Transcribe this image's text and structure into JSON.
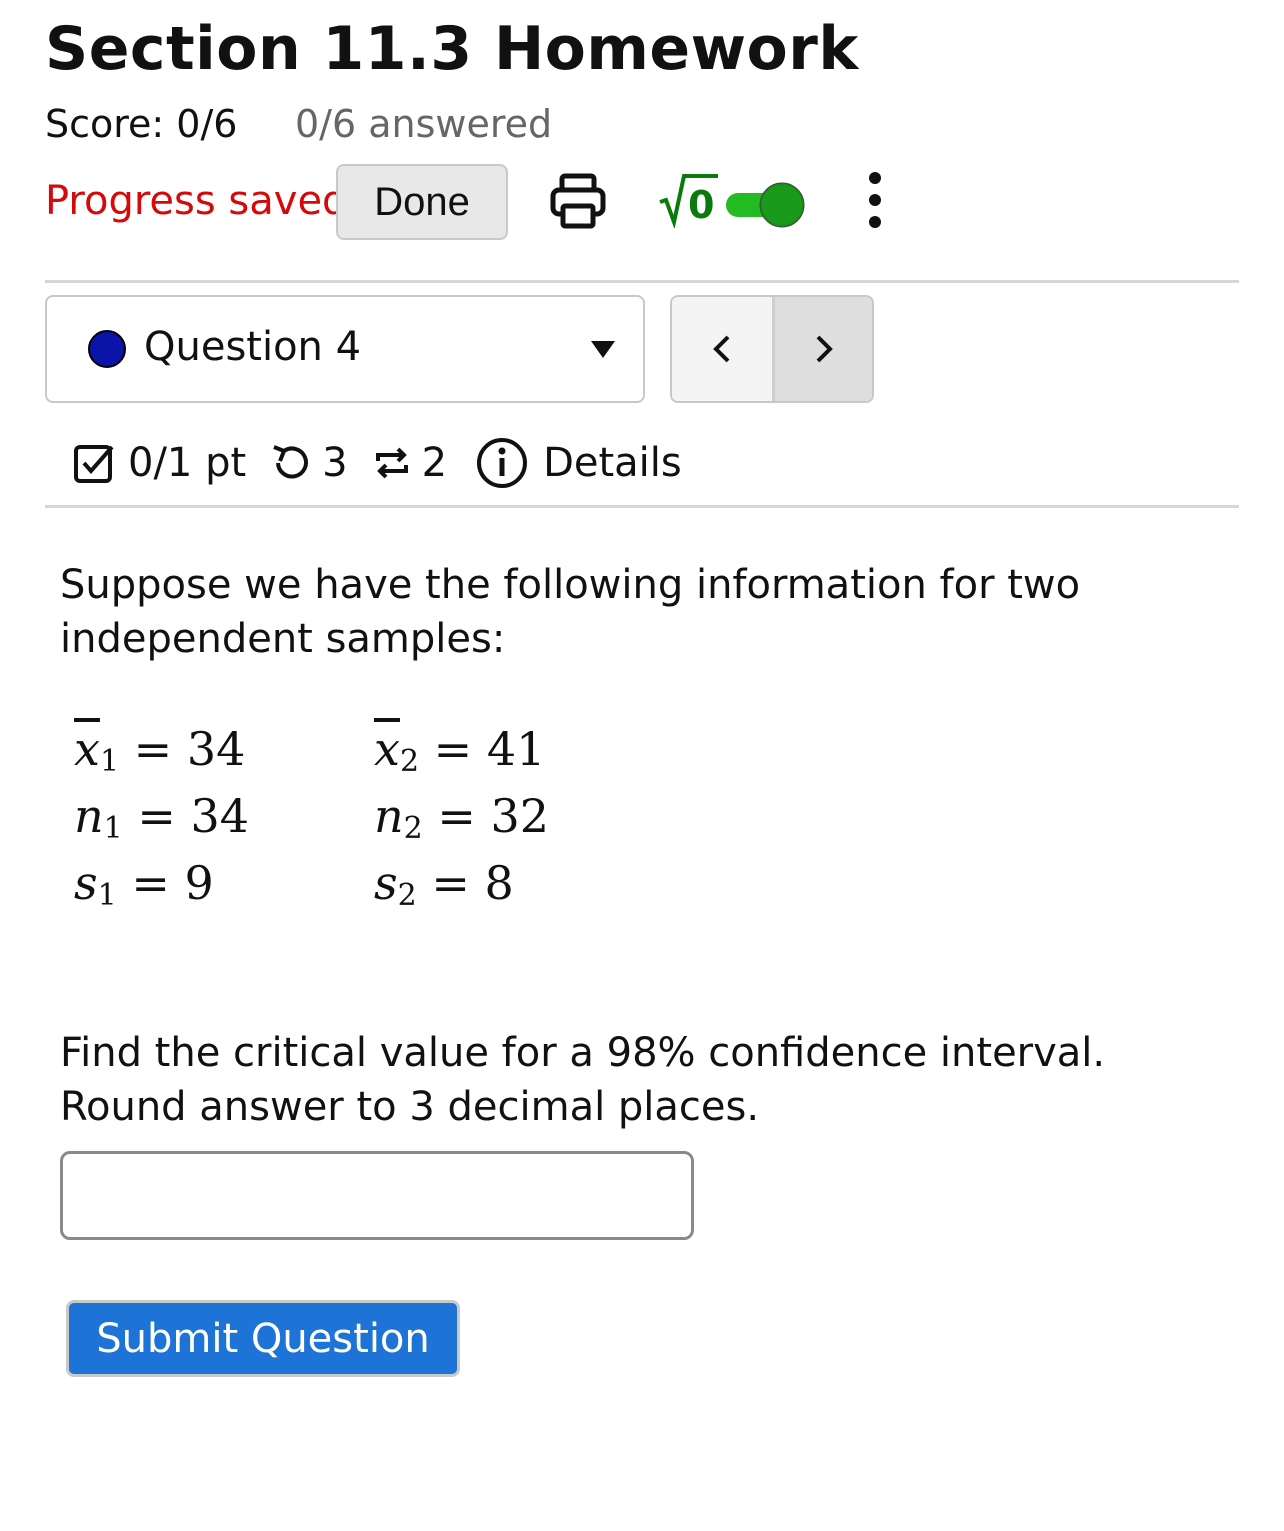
{
  "header": {
    "title": "Section 11.3 Homework",
    "score": "Score: 0/6",
    "answered": "0/6 answered"
  },
  "toolbar": {
    "progress_status": "Progress saved",
    "done_label": "Done",
    "print_icon": "printer-icon",
    "math_icon_label": "√0",
    "math_toggle_on": true,
    "menu_icon": "kebab-menu-icon",
    "colors": {
      "status_red": "#d40a0a",
      "toggle_green": "#1aa51a",
      "sqrt_green": "#0a7a0a"
    }
  },
  "question_nav": {
    "selected": "Question 4",
    "status_dot_color": "#0a14a8",
    "prev_icon": "chevron-left-icon",
    "next_icon": "chevron-right-icon"
  },
  "question_meta": {
    "points": "0/1 pt",
    "attempts": "3",
    "versions": "2",
    "details_label": "Details"
  },
  "question": {
    "intro": "Suppose we have the following information for two independent samples:",
    "sample1": {
      "xbar": "34",
      "n": "34",
      "s": "9"
    },
    "sample2": {
      "xbar": "41",
      "n": "32",
      "s": "8"
    },
    "prompt": "Find the critical value for a 98% confidence interval. Round answer to 3 decimal places.",
    "answer_value": "",
    "submit_label": "Submit Question",
    "submit_color": "#1d74d6"
  }
}
